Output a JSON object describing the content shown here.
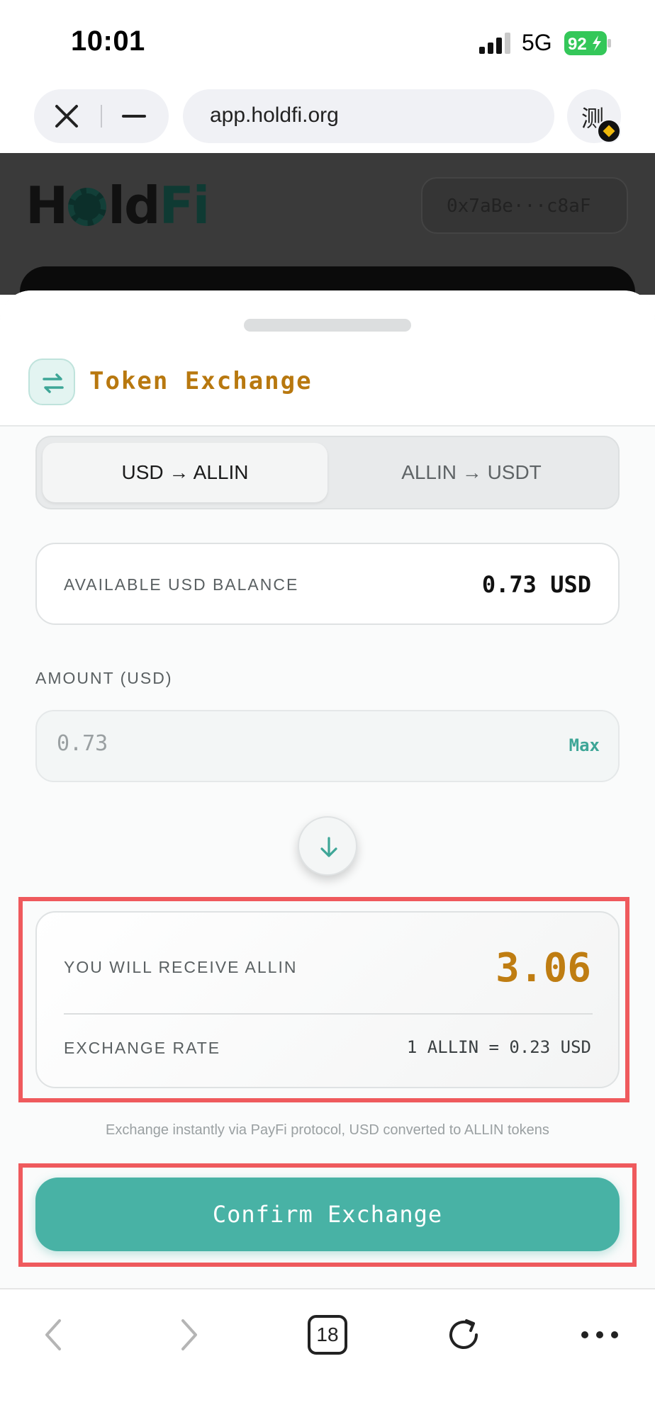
{
  "status_bar": {
    "time": "10:01",
    "network": "5G",
    "battery": "92"
  },
  "browser": {
    "url": "app.holdfi.org",
    "extension_label": "测"
  },
  "app": {
    "logo_part1": "H",
    "logo_part2": "ld",
    "logo_part3": "Fi",
    "wallet": "0x7aBe···c8aF"
  },
  "sheet": {
    "title": "Token Exchange",
    "tabs": [
      {
        "label": "USD → ALLIN",
        "active": true
      },
      {
        "label": "ALLIN → USDT",
        "active": false
      }
    ],
    "balance_label": "AVAILABLE USD BALANCE",
    "balance_value": "0.73 USD",
    "amount_label": "AMOUNT (USD)",
    "amount_placeholder": "0.73",
    "max_label": "Max",
    "receive_label": "YOU WILL RECEIVE ALLIN",
    "receive_value": "3.06",
    "rate_label": "EXCHANGE RATE",
    "rate_value": "1 ALLIN = 0.23 USD",
    "note": "Exchange instantly via PayFi protocol, USD converted to ALLIN tokens",
    "confirm_label": "Confirm Exchange"
  },
  "toolbar": {
    "tabs_count": "18"
  },
  "colors": {
    "accent": "#48b2a5",
    "gold": "#bf7d12",
    "highlight": "#ef5a5d"
  }
}
